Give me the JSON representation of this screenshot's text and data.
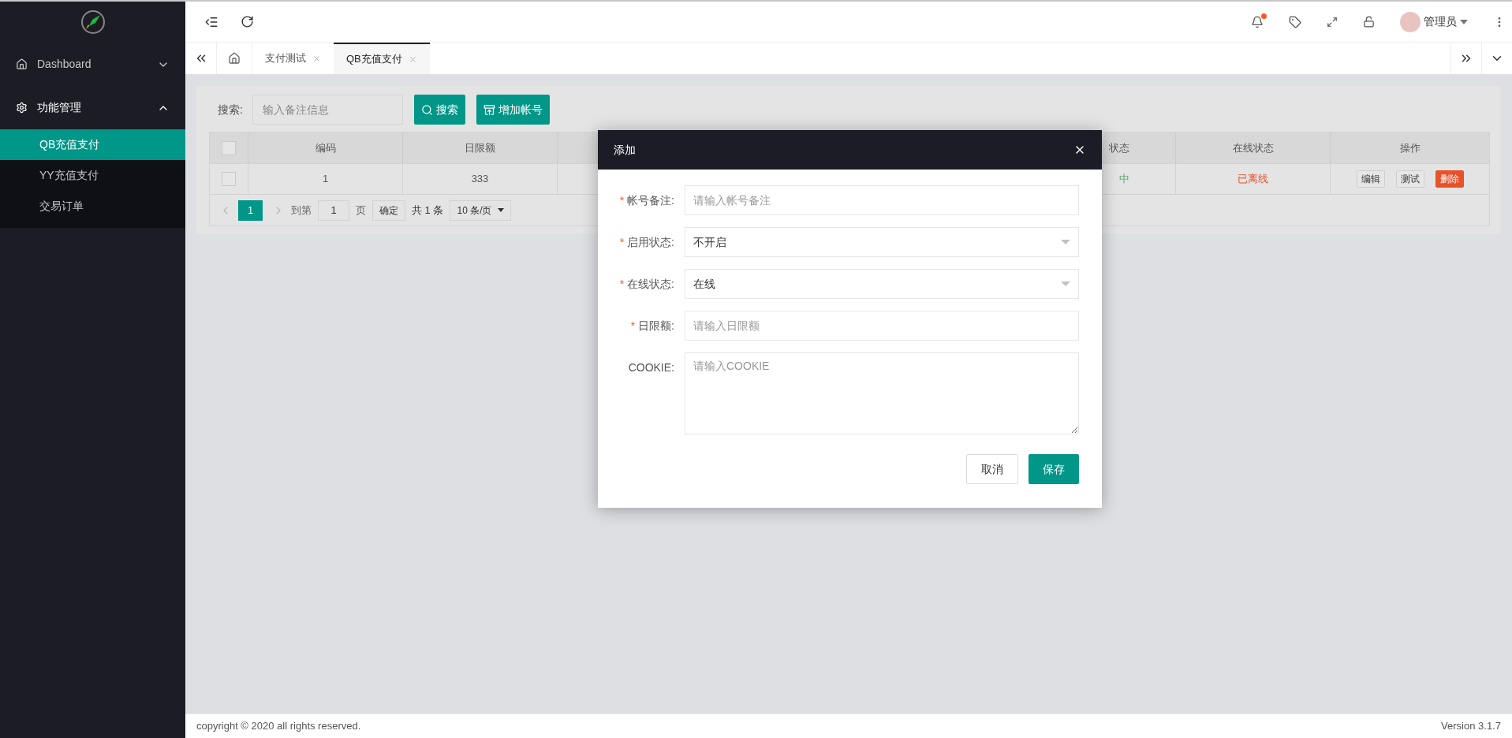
{
  "header": {
    "user": "管理员",
    "notification_unread": true
  },
  "sidebar": {
    "items": [
      {
        "label": "Dashboard",
        "expanded": false
      },
      {
        "label": "功能管理",
        "expanded": true,
        "children": [
          {
            "label": "QB充值支付",
            "selected": true
          },
          {
            "label": "YY充值支付",
            "selected": false
          },
          {
            "label": "交易订单",
            "selected": false
          }
        ]
      }
    ]
  },
  "tabs": [
    {
      "label": "支付测试",
      "selected": false
    },
    {
      "label": "QB充值支付",
      "selected": true
    }
  ],
  "toolbar": {
    "search_label": "搜索:",
    "search_placeholder": "输入备注信息",
    "buttons": [
      {
        "label": "搜索"
      },
      {
        "label": "增加帐号"
      }
    ]
  },
  "table": {
    "select_all_checked": false,
    "columns": [
      {
        "label": "编码"
      },
      {
        "label": "日限额"
      },
      {
        "label": "状态"
      },
      {
        "label": "在线状态"
      },
      {
        "label": "操作"
      }
    ],
    "rows": [
      {
        "checked": false,
        "cells": [
          "1",
          "333",
          "中",
          "已离线"
        ],
        "actions": [
          {
            "label": "编辑",
            "kind": "plain"
          },
          {
            "label": "测试",
            "kind": "plain"
          },
          {
            "label": "删除",
            "kind": "danger"
          }
        ]
      }
    ]
  },
  "pagination": {
    "pages": [
      {
        "label": "1",
        "selected": true
      }
    ],
    "goto_label": "到第",
    "goto_value": "1",
    "page_unit": "页",
    "confirm": "确定",
    "total": "共 1 条",
    "page_size": "10 条/页"
  },
  "dialog": {
    "title": "添加",
    "required_mark": "*",
    "fields": [
      {
        "label": "帐号备注:",
        "required": true,
        "kind": "input",
        "placeholder": "请输入帐号备注"
      },
      {
        "label": "启用状态:",
        "required": true,
        "kind": "select",
        "value": "不开启"
      },
      {
        "label": "在线状态:",
        "required": true,
        "kind": "select",
        "value": "在线"
      },
      {
        "label": "日限额:",
        "required": true,
        "kind": "input",
        "placeholder": "请输入日限额"
      },
      {
        "label": "COOKIE:",
        "required": false,
        "kind": "textarea",
        "placeholder": "请输入COOKIE"
      }
    ],
    "buttons": [
      {
        "label": "取消",
        "kind": "secondary"
      },
      {
        "label": "保存",
        "kind": "primary"
      }
    ]
  },
  "footer": {
    "copyright": "copyright © 2020 all rights reserved.",
    "version": "Version 3.1.7"
  }
}
